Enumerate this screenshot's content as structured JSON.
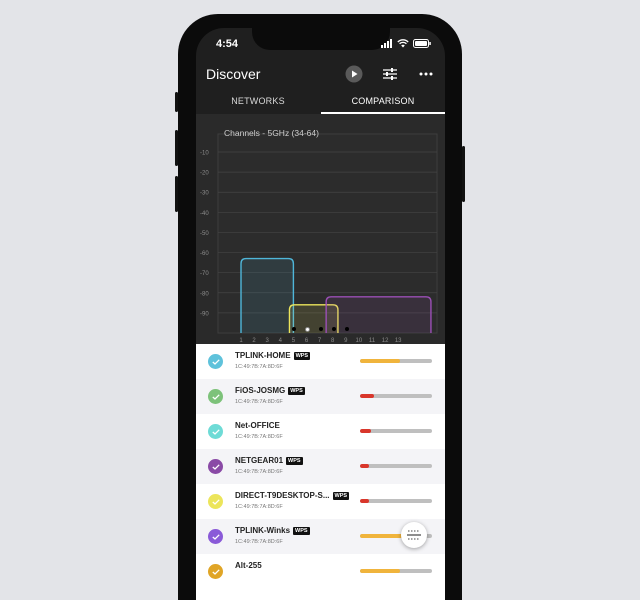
{
  "status": {
    "time": "4:54"
  },
  "header": {
    "title": "Discover"
  },
  "tabs": [
    {
      "label": "NETWORKS"
    },
    {
      "label": "COMPARISON",
      "active": true
    }
  ],
  "chart_data": {
    "type": "area",
    "title": "Channels - 5GHz (34-64)",
    "ylim": [
      -100,
      -10
    ],
    "y_ticks": [
      "-10",
      "-20",
      "-30",
      "-40",
      "-50",
      "-60",
      "-70",
      "-80",
      "-90"
    ],
    "x_ticks": [
      "1",
      "2",
      "3",
      "4",
      "5",
      "6",
      "7",
      "8",
      "9",
      "10",
      "11",
      "12",
      "13"
    ],
    "series": [
      {
        "color": "#4fb6d9",
        "x_start": 1,
        "x_end": 5,
        "signal_dbm": -63
      },
      {
        "color": "#ece55b",
        "x_start": 4.7,
        "x_end": 8.4,
        "signal_dbm": -86
      },
      {
        "color": "#9a4fb5",
        "x_start": 7.5,
        "x_end": 15.5,
        "signal_dbm": -82
      }
    ]
  },
  "pager": {
    "count": 5,
    "active": 1
  },
  "networks": [
    {
      "ssid": "TPLINK-HOME",
      "wps": "WPS",
      "mac": "1C:49:7B:7A:8D:6F",
      "color": "#5fc2db",
      "signal": 0.55,
      "bar_color": "#f0b43c"
    },
    {
      "ssid": "FiOS-JOSMG",
      "wps": "WPS",
      "mac": "1C:49:7B:7A:8D:6F",
      "color": "#7dc27a",
      "signal": 0.2,
      "bar_color": "#d9362b"
    },
    {
      "ssid": "Net-OFFICE",
      "wps": "",
      "mac": "1C:49:7B:7A:8D:6F",
      "color": "#6edbd6",
      "signal": 0.15,
      "bar_color": "#d9362b"
    },
    {
      "ssid": "NETGEAR01",
      "wps": "WPS",
      "mac": "1C:49:7B:7A:8D:6F",
      "color": "#8a4aa6",
      "signal": 0.12,
      "bar_color": "#d9362b"
    },
    {
      "ssid": "DIRECT-T9DESKTOP-S...",
      "wps": "WPS",
      "mac": "1C:49:7B:7A:8D:6F",
      "color": "#ece55b",
      "signal": 0.12,
      "bar_color": "#d9362b"
    },
    {
      "ssid": "TPLINK-Winks",
      "wps": "WPS",
      "mac": "1C:49:7B:7A:8D:6F",
      "color": "#8a5ad8",
      "signal": 0.62,
      "bar_color": "#f0b43c"
    },
    {
      "ssid": "Alt-255",
      "wps": "",
      "mac": "",
      "color": "#e0a526",
      "signal": 0.55,
      "bar_color": "#f0b43c"
    }
  ],
  "icons": {
    "play": "play-icon",
    "filter": "sliders-icon",
    "more": "more-icon",
    "fab": "scan-icon"
  }
}
